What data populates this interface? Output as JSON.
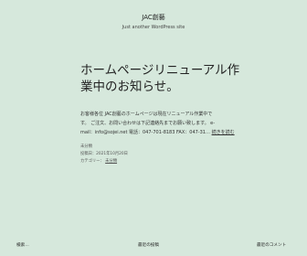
{
  "header": {
    "site_title": "JAC創藝",
    "tagline": "Just another WordPress site"
  },
  "post": {
    "title": "ホームページリニューアル作業中のお知らせ。",
    "body_line1": "お客様各位  JAC創藝のホームページは現在リニューアル作業中で",
    "body_line2": "す。  ご注文、お問い合わせは下記連絡先までお願い致します。  e-",
    "body_line3_prefix": "mail：info@sojei.net  電話：047-701-8183  FAX：047-31…",
    "read_more": "続きを読む"
  },
  "meta": {
    "category": "未分類",
    "date": "投稿日：2021年10月20日",
    "category_label": "カテゴリー：",
    "category_link": "未分類"
  },
  "footer": {
    "search_placeholder": "検索…",
    "recent_posts": "最近の投稿",
    "recent_comments": "最近のコメント"
  }
}
